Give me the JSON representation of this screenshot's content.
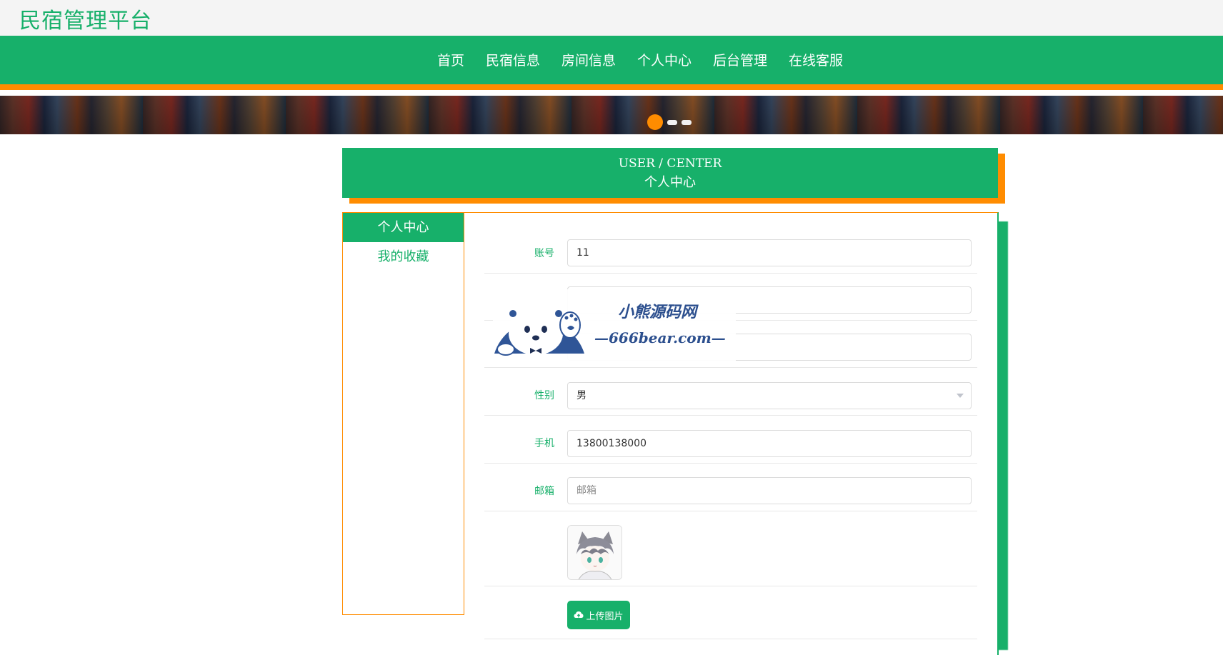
{
  "brand": "民宿管理平台",
  "nav": [
    "首页",
    "民宿信息",
    "房间信息",
    "个人中心",
    "后台管理",
    "在线客服"
  ],
  "banner": {
    "slides": 3,
    "active_slide": 1
  },
  "section_title": {
    "en": "USER / CENTER",
    "zh": "个人中心"
  },
  "sidebar": {
    "items": [
      {
        "label": "个人中心",
        "active": true
      },
      {
        "label": "我的收藏",
        "active": false
      }
    ]
  },
  "form": {
    "account_label": "账号",
    "account_value": "11",
    "gender_label": "性别",
    "gender_value": "男",
    "phone_label": "手机",
    "phone_value": "13800138000",
    "email_label": "邮箱",
    "email_placeholder": "邮箱",
    "upload_label": "上传图片"
  },
  "watermark": {
    "line1": "小熊源码网",
    "line2": "—666bear.com—"
  },
  "colors": {
    "primary": "#17b06a",
    "accent": "#ff8c00"
  }
}
